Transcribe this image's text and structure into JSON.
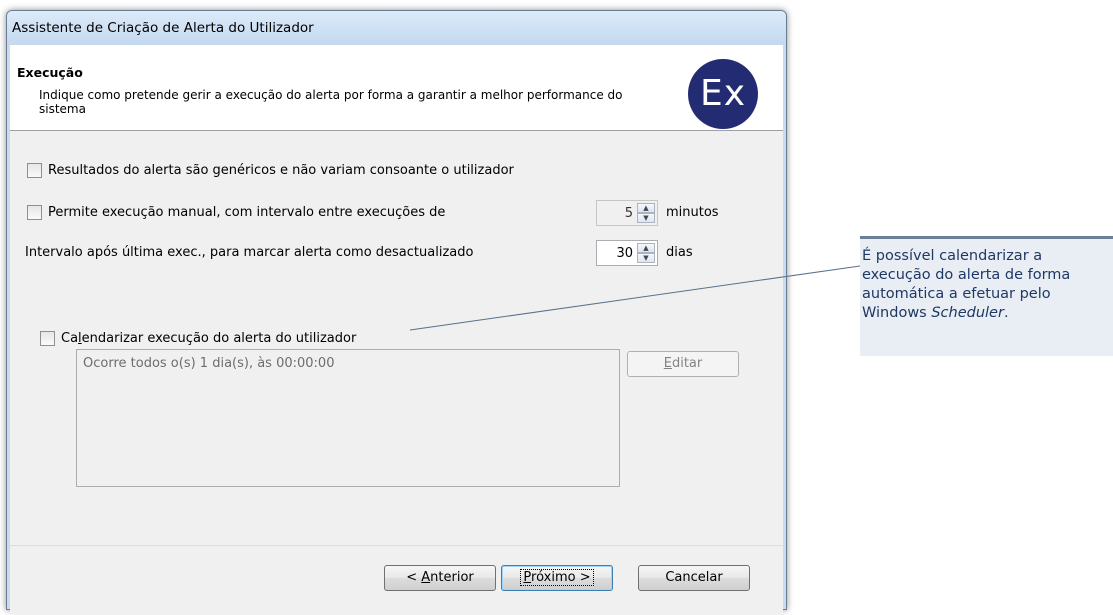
{
  "window": {
    "title": "Assistente de Criação de Alerta do Utilizador"
  },
  "header": {
    "title": "Execução",
    "description": "Indique como pretende gerir a execução do alerta por forma a garantir a melhor performance do sistema",
    "logo_text": "Ex",
    "logo_color": "#232c72"
  },
  "options": {
    "generic_results_label": "Resultados do alerta são genéricos e não variam consoante o utilizador",
    "generic_results_checked": false,
    "manual_exec_label": "Permite execução manual, com intervalo entre execuções de",
    "manual_exec_checked": false,
    "manual_exec_value": "5",
    "manual_exec_unit": "minutos",
    "outdated_label": "Intervalo após última exec., para marcar alerta como desactualizado",
    "outdated_value": "30",
    "outdated_unit": "dias"
  },
  "schedule": {
    "label_pre": "Ca",
    "label_mnemonic": "l",
    "label_post": "endarizar execução do alerta do utilizador",
    "checked": false,
    "summary": "Ocorre todos o(s) 1 dia(s), às 00:00:00",
    "edit_mnemonic": "E",
    "edit_rest": "ditar"
  },
  "buttons": {
    "back_pre": "< ",
    "back_mnemonic": "A",
    "back_rest": "nterior",
    "next_mnemonic": "P",
    "next_rest": "róximo >",
    "cancel": "Cancelar"
  },
  "callout": {
    "text": "É possível calendarizar a execução do alerta de forma automática a efetuar pelo Windows ",
    "text_italic": "Scheduler",
    "text_end": "."
  },
  "icons": {
    "spin_up": "spin-up-arrow-icon",
    "spin_down": "spin-down-arrow-icon"
  }
}
